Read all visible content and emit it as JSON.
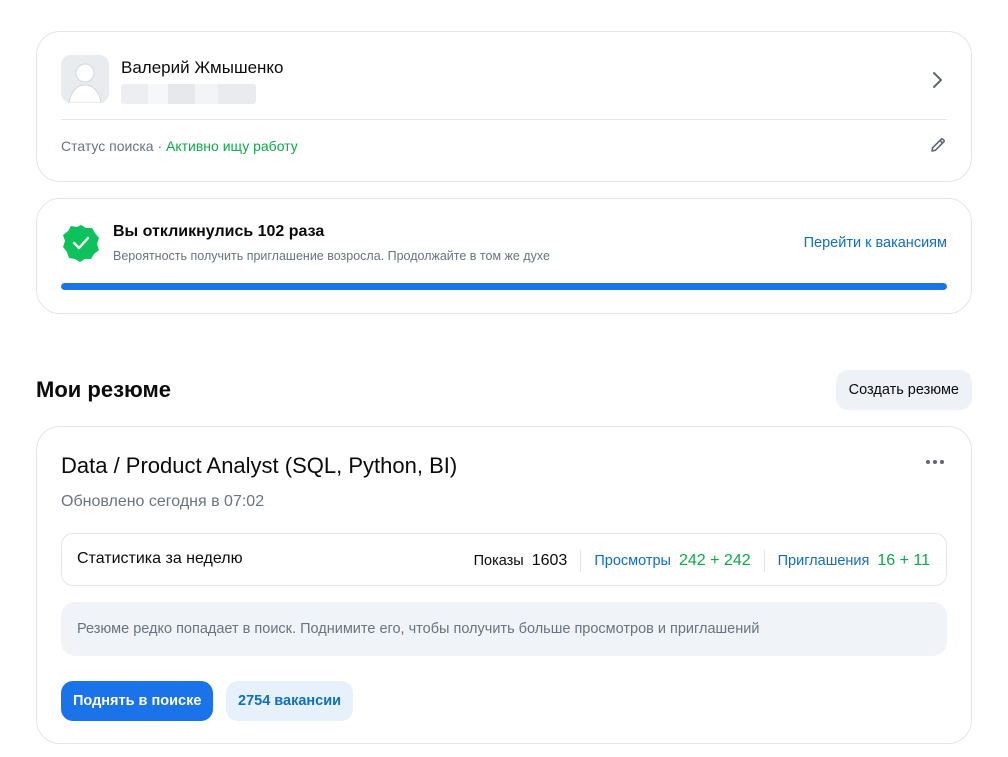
{
  "profile": {
    "name": "Валерий Жмышенко",
    "status_label": "Статус поиска",
    "status_separator": "·",
    "status_value": "Активно ищу работу"
  },
  "responses": {
    "title": "Вы откликнулись 102 раза",
    "subtitle": "Вероятность получить приглашение возросла. Продолжайте в том же духе",
    "link": "Перейти к вакансиям",
    "progress": 1.0
  },
  "resumes_section": {
    "title": "Мои резюме",
    "create_button": "Создать резюме"
  },
  "resume": {
    "title": "Data / Product Analyst (SQL, Python, BI)",
    "updated": "Обновлено сегодня в 07:02",
    "stats": {
      "label": "Статистика за неделю",
      "shows_label": "Показы",
      "shows_value": "1603",
      "views_label": "Просмотры",
      "views_value": "242 + 242",
      "invites_label": "Приглашения",
      "invites_value": "16 + 11"
    },
    "hint": "Резюме редко попадает в поиск. Поднимите его, чтобы получить больше просмотров и приглашений",
    "raise_button": "Поднять в поиске",
    "vacancies_button": "2754 вакансии"
  },
  "colors": {
    "accent_blue": "#1a73e8",
    "link_blue": "#0f6fc5",
    "success_green": "#0ea84b"
  },
  "icons": {
    "avatar": "avatar-placeholder-icon",
    "chevron": "chevron-right-icon",
    "edit": "pencil-icon",
    "badge": "check-badge-icon",
    "more": "more-dots-icon"
  }
}
